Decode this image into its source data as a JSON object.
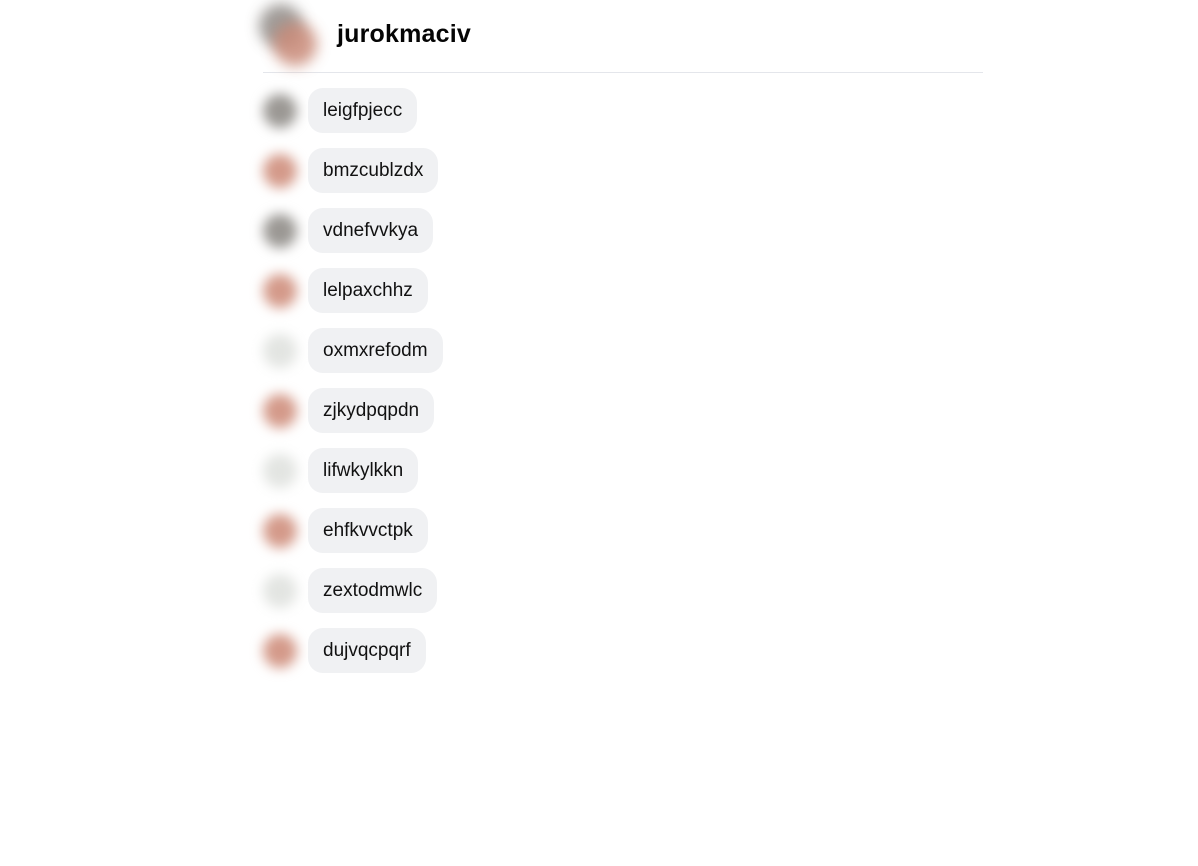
{
  "conversation": {
    "title": "jurokmaciv"
  },
  "members": [
    {
      "name": "leigfpjecc",
      "avatar_tone": "gray"
    },
    {
      "name": "bmzcublzdx",
      "avatar_tone": "red"
    },
    {
      "name": "vdnefvvkya",
      "avatar_tone": "gray"
    },
    {
      "name": "lelpaxchhz",
      "avatar_tone": "red"
    },
    {
      "name": "oxmxrefodm",
      "avatar_tone": "light"
    },
    {
      "name": "zjkydpqpdn",
      "avatar_tone": "red"
    },
    {
      "name": "lifwkylkkn",
      "avatar_tone": "light"
    },
    {
      "name": "ehfkvvctpk",
      "avatar_tone": "red"
    },
    {
      "name": "zextodmwlc",
      "avatar_tone": "light"
    },
    {
      "name": "dujvqcpqrf",
      "avatar_tone": "red"
    }
  ],
  "colors": {
    "bubble": "#f0f1f3",
    "divider": "#e4e6eb",
    "text": "#050505"
  }
}
